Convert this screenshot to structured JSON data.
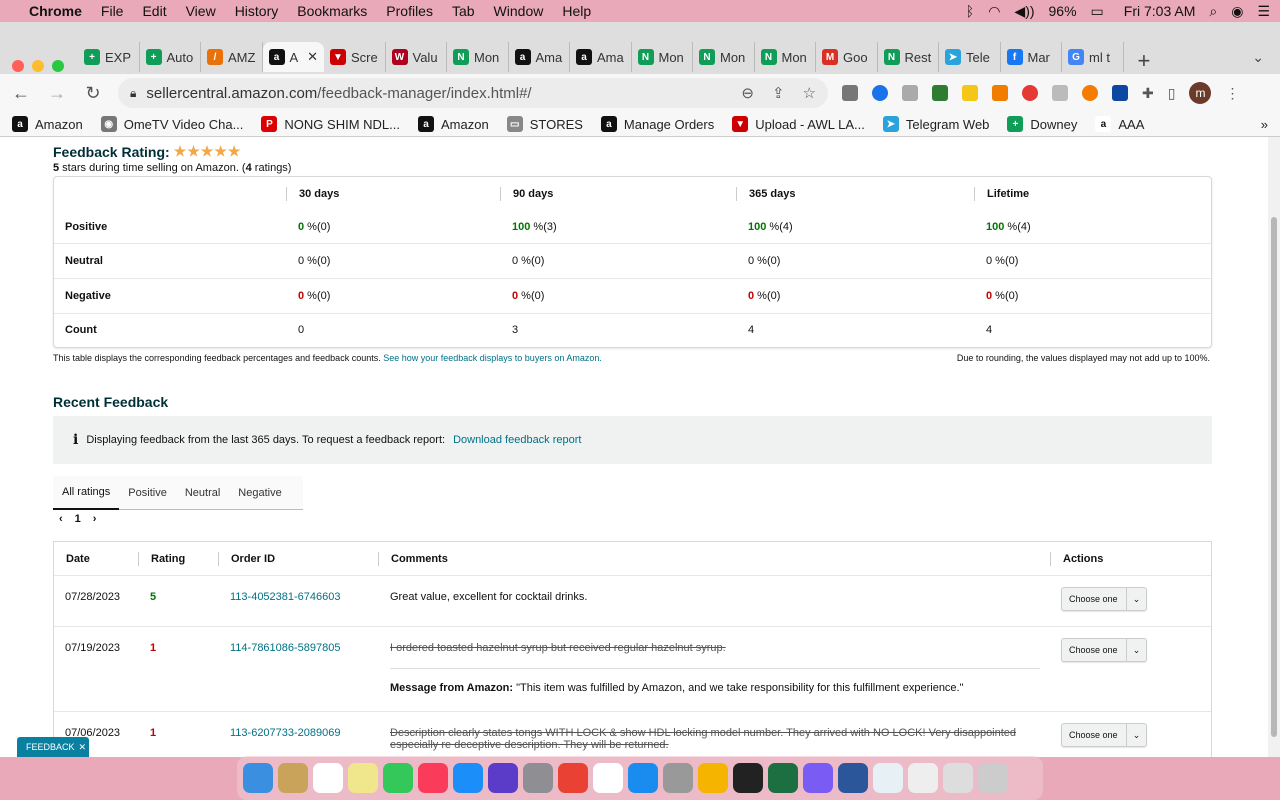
{
  "menubar": {
    "app": "Chrome",
    "items": [
      "File",
      "Edit",
      "View",
      "History",
      "Bookmarks",
      "Profiles",
      "Tab",
      "Window",
      "Help"
    ],
    "battery": "96%",
    "clock": "Fri 7:03 AM"
  },
  "tabs": [
    {
      "label": "EXP",
      "color": "#0f9d58",
      "glyph": "+"
    },
    {
      "label": "Auto",
      "color": "#0f9d58",
      "glyph": "+"
    },
    {
      "label": "AMZ",
      "color": "#e8710a",
      "glyph": "/"
    },
    {
      "label": "A",
      "color": "#111",
      "glyph": "a",
      "active": true
    },
    {
      "label": "Scre",
      "color": "#c00",
      "glyph": "▼"
    },
    {
      "label": "Valu",
      "color": "#b00020",
      "glyph": "W"
    },
    {
      "label": "Mon",
      "color": "#0f9d58",
      "glyph": "N"
    },
    {
      "label": "Ama",
      "color": "#111",
      "glyph": "a"
    },
    {
      "label": "Ama",
      "color": "#111",
      "glyph": "a"
    },
    {
      "label": "Mon",
      "color": "#0f9d58",
      "glyph": "N"
    },
    {
      "label": "Mon",
      "color": "#0f9d58",
      "glyph": "N"
    },
    {
      "label": "Mon",
      "color": "#0f9d58",
      "glyph": "N"
    },
    {
      "label": "Goo",
      "color": "#d93025",
      "glyph": "M"
    },
    {
      "label": "Rest",
      "color": "#0f9d58",
      "glyph": "N"
    },
    {
      "label": "Tele",
      "color": "#2aa3dc",
      "glyph": "➤"
    },
    {
      "label": "Mar",
      "color": "#1877f2",
      "glyph": "f"
    },
    {
      "label": "ml t",
      "color": "#4285f4",
      "glyph": "G"
    }
  ],
  "url": {
    "host": "sellercentral.amazon.com",
    "path": "/feedback-manager/index.html#/"
  },
  "bookmarks": [
    {
      "label": "Amazon",
      "color": "#111",
      "glyph": "a"
    },
    {
      "label": "OmeTV Video Cha...",
      "color": "#777",
      "glyph": "◉"
    },
    {
      "label": "NONG SHIM NDL...",
      "color": "#d00",
      "glyph": "P"
    },
    {
      "label": "Amazon",
      "color": "#111",
      "glyph": "a"
    },
    {
      "label": "STORES",
      "color": "#888",
      "glyph": "▭"
    },
    {
      "label": "Manage Orders",
      "color": "#111",
      "glyph": "a"
    },
    {
      "label": "Upload - AWL LA...",
      "color": "#c00",
      "glyph": "▼"
    },
    {
      "label": "Telegram Web",
      "color": "#2aa3dc",
      "glyph": "➤"
    },
    {
      "label": "Downey",
      "color": "#0f9d58",
      "glyph": "+"
    },
    {
      "label": "AAA",
      "color": "#fff",
      "glyph": "a"
    }
  ],
  "feedback": {
    "title": "Feedback Rating:",
    "stars": "★★★★★",
    "sub_stars": "5",
    "sub_text_1": " stars during time selling on Amazon. (",
    "sub_count": "4",
    "sub_text_2": " ratings)",
    "columns": [
      "30 days",
      "90 days",
      "365 days",
      "Lifetime"
    ],
    "rows": [
      {
        "label": "Positive",
        "cls": "g",
        "cells": [
          [
            "0",
            " %(0)"
          ],
          [
            "100",
            " %(3)"
          ],
          [
            "100",
            " %(4)"
          ],
          [
            "100",
            " %(4)"
          ]
        ]
      },
      {
        "label": "Neutral",
        "cls": "",
        "cells": [
          [
            "0",
            " %(0)"
          ],
          [
            "0",
            " %(0)"
          ],
          [
            "0",
            " %(0)"
          ],
          [
            "0",
            " %(0)"
          ]
        ]
      },
      {
        "label": "Negative",
        "cls": "rd",
        "cells": [
          [
            "0",
            " %(0)"
          ],
          [
            "0",
            " %(0)"
          ],
          [
            "0",
            " %(0)"
          ],
          [
            "0",
            " %(0)"
          ]
        ]
      },
      {
        "label": "Count",
        "cls": "plain",
        "cells": [
          [
            "0",
            ""
          ],
          [
            "3",
            ""
          ],
          [
            "4",
            ""
          ],
          [
            "4",
            ""
          ]
        ]
      }
    ],
    "note_left": "This table displays the corresponding feedback percentages and feedback counts. ",
    "note_link": "See how your feedback displays to buyers on Amazon.",
    "note_right": "Due to rounding, the values displayed may not add up to 100%."
  },
  "recent": {
    "title": "Recent Feedback",
    "info_text": "Displaying feedback from the last 365 days. To request a feedback report:",
    "info_link": "Download feedback report",
    "tabs": [
      "All ratings",
      "Positive",
      "Neutral",
      "Negative"
    ],
    "page": "1",
    "headers": [
      "Date",
      "Rating",
      "Order ID",
      "Comments",
      "Actions"
    ],
    "action_label": "Choose one",
    "rows": [
      {
        "date": "07/28/2023",
        "rating": "5",
        "rcls": "g",
        "order": "113-4052381-6746603",
        "comment": "Great value, excellent for cocktail drinks.",
        "strike": false,
        "msg_label": "",
        "msg": ""
      },
      {
        "date": "07/19/2023",
        "rating": "1",
        "rcls": "rd",
        "order": "114-7861086-5897805",
        "comment": "I ordered toasted hazelnut syrup but received regular hazelnut syrup.",
        "strike": true,
        "msg_label": "Message from Amazon:",
        "msg": " \"This item was fulfilled by Amazon, and we take responsibility for this fulfillment experience.\""
      },
      {
        "date": "07/06/2023",
        "rating": "1",
        "rcls": "rd",
        "order": "113-6207733-2089069",
        "comment": "Description clearly states tongs WITH LOCK & show HDL locking model number. They arrived with NO LOCK! Very disappointed especially re deceptive description. They will be returned.",
        "strike": true,
        "msg_label": "",
        "msg": ""
      }
    ]
  },
  "feedback_tab": "FEEDBACK",
  "dock": [
    {
      "name": "finder",
      "color": "#3b8fe0"
    },
    {
      "name": "notes-app",
      "color": "#c9a35a"
    },
    {
      "name": "calendar",
      "color": "#fff"
    },
    {
      "name": "stickies",
      "color": "#f0e68c"
    },
    {
      "name": "facetime",
      "color": "#34c759"
    },
    {
      "name": "music",
      "color": "#fa3c5a"
    },
    {
      "name": "app-store",
      "color": "#1c8ef9"
    },
    {
      "name": "siri",
      "color": "#5a3cc8"
    },
    {
      "name": "settings",
      "color": "#8e8e93"
    },
    {
      "name": "chrome",
      "color": "#e94235"
    },
    {
      "name": "reminders",
      "color": "#fff"
    },
    {
      "name": "safari",
      "color": "#1a8cf0"
    },
    {
      "name": "launchpad",
      "color": "#999"
    },
    {
      "name": "photos",
      "color": "#f4b400"
    },
    {
      "name": "terminal",
      "color": "#222"
    },
    {
      "name": "excel",
      "color": "#1d6f42"
    },
    {
      "name": "messenger",
      "color": "#7a5cf5"
    },
    {
      "name": "word",
      "color": "#2b579a"
    },
    {
      "name": "activity-monitor",
      "color": "#e6f0f5"
    },
    {
      "name": "documents",
      "color": "#eee"
    },
    {
      "name": "downloads",
      "color": "#ddd"
    },
    {
      "name": "trash",
      "color": "#ccc"
    }
  ]
}
